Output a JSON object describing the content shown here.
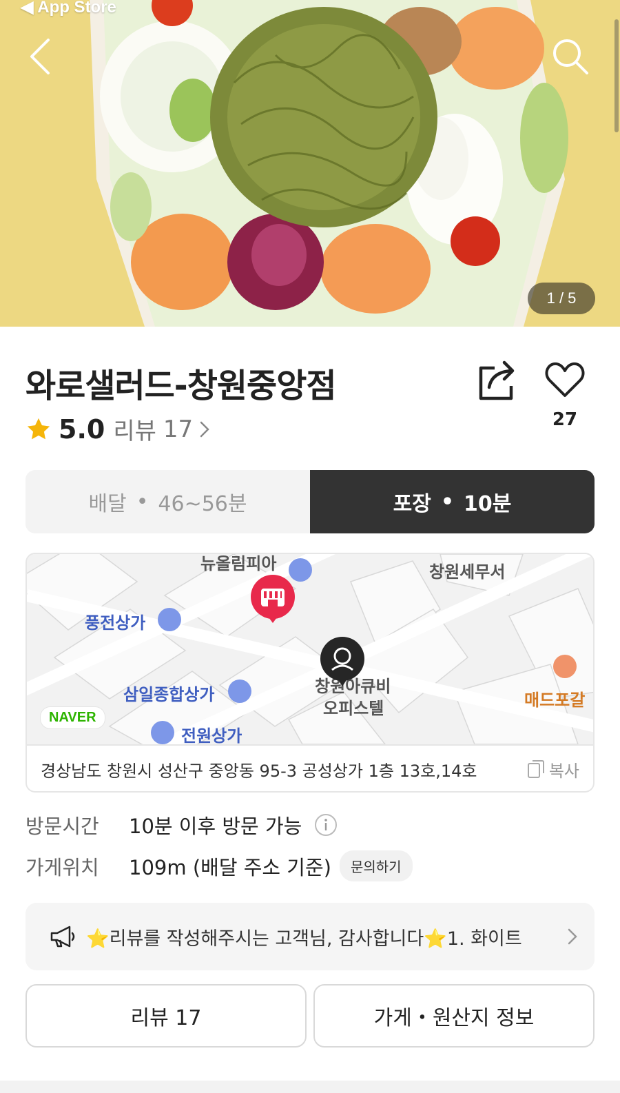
{
  "status_bar": {
    "back_app": "◀ App Store"
  },
  "hero": {
    "page_indicator": "1 / 5"
  },
  "store": {
    "name": "와로샐러드-창원중앙점",
    "rating": "5.0",
    "review_label": "리뷰",
    "review_count": "17",
    "favorite_count": "27"
  },
  "order_mode": {
    "delivery": {
      "label": "배달",
      "time": "46~56분"
    },
    "pickup": {
      "label": "포장",
      "time": "10분"
    },
    "selected": "pickup"
  },
  "map": {
    "watermark": "NAVER",
    "pois": {
      "newolympia": "뉴올림피아",
      "tax_office": "창원세무서",
      "pungjeon": "풍전상가",
      "samil": "삼일종합상가",
      "officetel_1": "창원아큐비",
      "officetel_2": "오피스텔",
      "madpo": "매드포갈",
      "jeonwon": "전원상가"
    },
    "address": "경상남도 창원시 성산구 중앙동 95-3 공성상가 1층 13호,14호",
    "copy_label": "복사"
  },
  "info": {
    "visit_label": "방문시간",
    "visit_value": "10분 이후 방문 가능",
    "location_label": "가게위치",
    "location_value": "109m (배달 주소 기준)",
    "inquiry_label": "문의하기"
  },
  "notice": {
    "text": "⭐리뷰를 작성해주시는 고객님, 감사합니다⭐1. 화이트"
  },
  "buttons": {
    "reviews": "리뷰 17",
    "store_info": "가게・원산지 정보"
  },
  "colors": {
    "star": "#f5b50a",
    "selected_segment": "#333333",
    "store_pin": "#e8294b",
    "naver_green": "#2db400"
  }
}
